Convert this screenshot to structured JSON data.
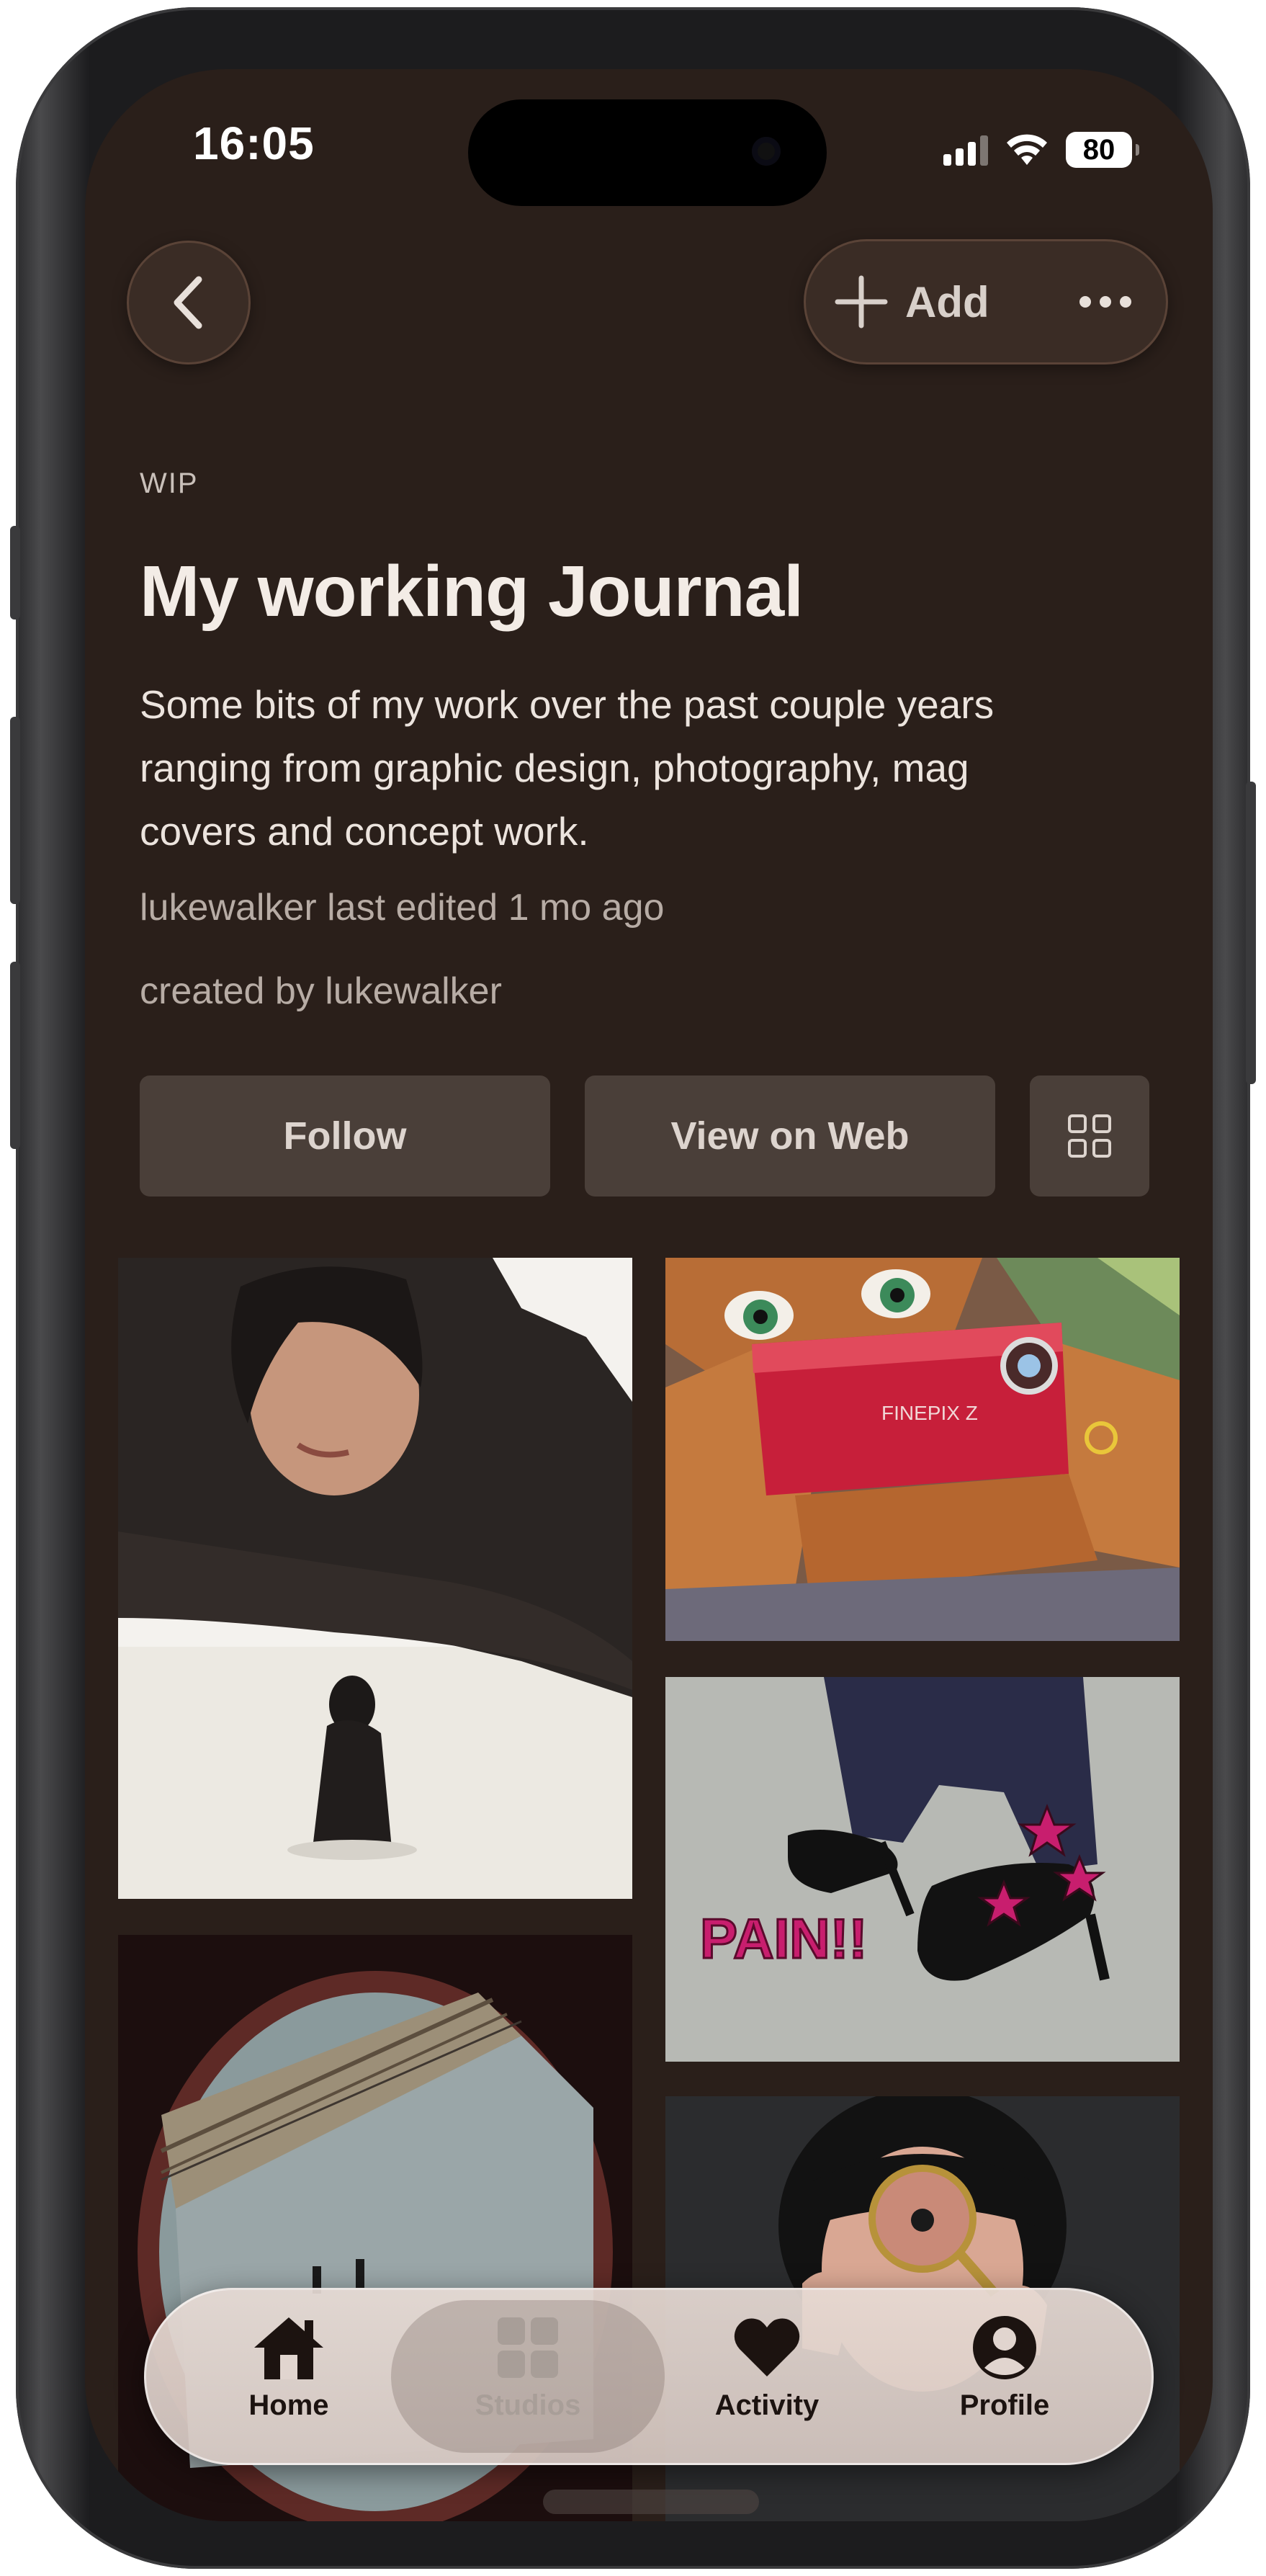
{
  "status_bar": {
    "time": "16:05",
    "battery": "80",
    "icons": [
      "signal-icon",
      "wifi-icon",
      "battery-icon"
    ]
  },
  "header": {
    "back_icon": "chevron-left-icon",
    "add_label": "Add",
    "add_icon": "plus-icon",
    "more_icon": "ellipsis-icon"
  },
  "collection": {
    "kicker": "WIP",
    "title": "My working Journal",
    "description_lines": [
      "Some bits of my work over the past couple years",
      "ranging from graphic design, photography, mag",
      "covers and concept work."
    ],
    "last_edited": "lukewalker last edited 1 mo ago",
    "created_by": "created by lukewalker"
  },
  "actions": {
    "follow_label": "Follow",
    "view_web_label": "View on Web",
    "grid_icon": "grid-view-icon"
  },
  "gallery": {
    "images": [
      "woman-lying-on-arm-photo",
      "3d-character-holding-red-camera-image",
      "black-heels-with-pink-stars-pain-image",
      "aerial-road-through-circular-vignette-photo",
      "woman-with-magnifying-glass-photo"
    ],
    "pain_text": "PAIN!!"
  },
  "tab_bar": {
    "items": [
      {
        "label": "Home",
        "icon": "home-icon"
      },
      {
        "label": "Studios",
        "icon": "studios-grid-icon"
      },
      {
        "label": "Activity",
        "icon": "heart-icon"
      },
      {
        "label": "Profile",
        "icon": "profile-icon"
      }
    ],
    "active": "Studios"
  },
  "colors": {
    "background": "#2a1f1a",
    "button": "#4a3f39",
    "text": "#f3ece6",
    "muted_text": "#b7aca5",
    "accent_pink": "#c81e6e"
  }
}
